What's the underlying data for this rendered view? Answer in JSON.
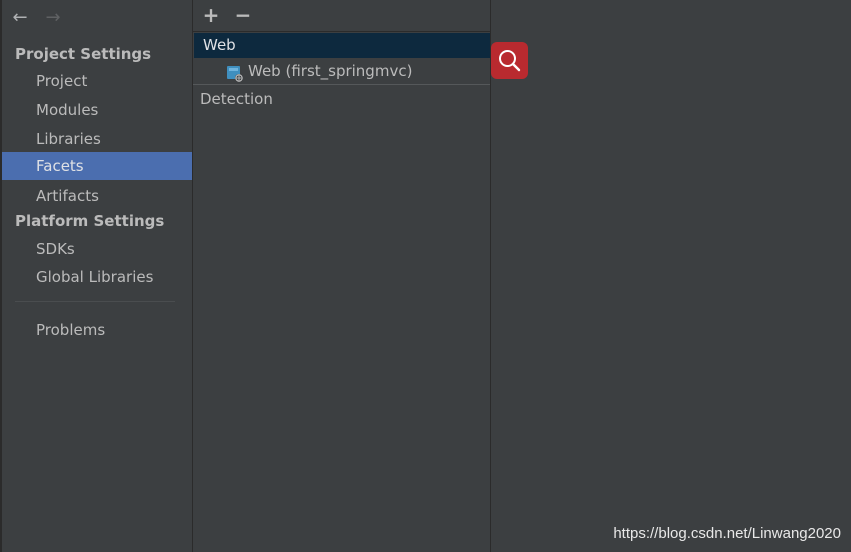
{
  "nav": {
    "back_icon": "arrow-left-icon",
    "forward_icon": "arrow-right-icon"
  },
  "sidebar": {
    "project_settings_header": "Project Settings",
    "project_items": [
      {
        "label": "Project"
      },
      {
        "label": "Modules"
      },
      {
        "label": "Libraries"
      },
      {
        "label": "Facets",
        "selected": true
      },
      {
        "label": "Artifacts"
      }
    ],
    "platform_settings_header": "Platform Settings",
    "platform_items": [
      {
        "label": "SDKs"
      },
      {
        "label": "Global Libraries"
      }
    ],
    "problems_label": "Problems"
  },
  "facets_toolbar": {
    "add_label": "+",
    "remove_label": "−"
  },
  "facets_tree": {
    "group_label": "Web",
    "child_label": "Web (first_springmvc)",
    "detection_label": "Detection"
  },
  "watermark": "https://blog.csdn.net/Linwang2020",
  "colors": {
    "background": "#3c3f41",
    "selection": "#4b6eaf",
    "tree_group": "#0d293e",
    "search_button": "#b92a2f"
  }
}
